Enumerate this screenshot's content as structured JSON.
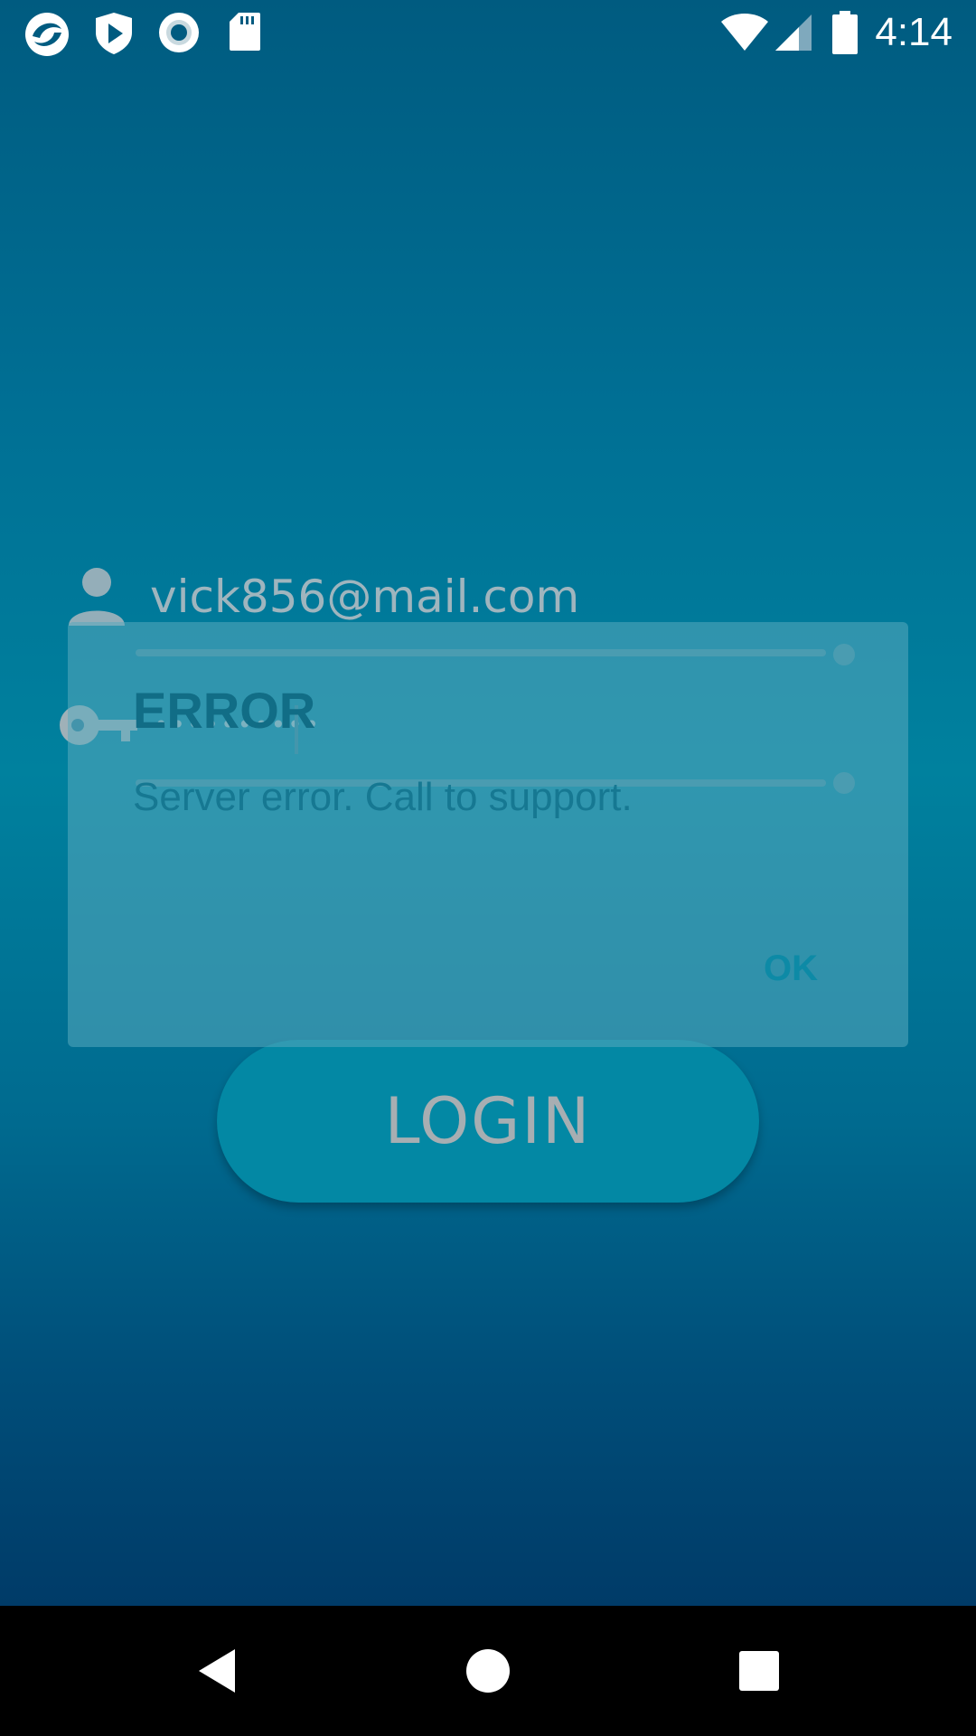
{
  "status_bar": {
    "time": "4:14",
    "left_icons": [
      "app-logo-icon",
      "shield-play-icon",
      "record-icon",
      "sd-card-icon"
    ],
    "right_icons": [
      "wifi-icon",
      "cell-signal-icon",
      "battery-icon"
    ]
  },
  "login": {
    "email_value": "vick856@mail.com",
    "password_mask": "••••••••••",
    "button_label": "LOGIN"
  },
  "dialog": {
    "title": "ERROR",
    "message": "Server error. Call to support.",
    "ok_label": "OK"
  },
  "nav_bar": {
    "icons": [
      "back-icon",
      "home-icon",
      "recents-icon"
    ]
  },
  "colors": {
    "accent": "#0388a4",
    "background_top": "#005b80",
    "background_bottom": "#003b68"
  }
}
